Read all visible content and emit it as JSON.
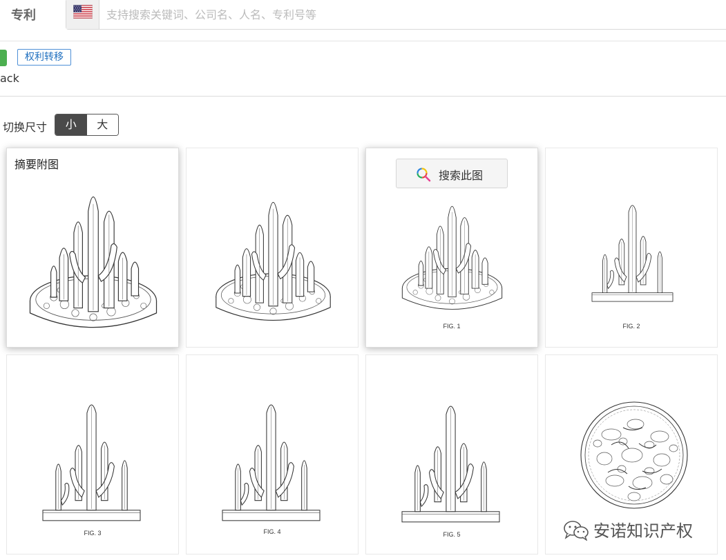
{
  "header": {
    "tab_label": "专利",
    "flag_icon": "us-flag-icon",
    "search_placeholder": "支持搜索关键词、公司名、人名、专利号等"
  },
  "tags": {
    "right_transfer": "权利转移",
    "partial_text": "ack",
    "badge_color": "#4caf50",
    "tag_color": "#1f6fbf"
  },
  "size_switch": {
    "label": "切换尺寸",
    "small": "小",
    "large": "大",
    "selected": "小"
  },
  "gallery": {
    "abstract_label": "摘要附图",
    "search_image_label": "搜索此图",
    "figures": [
      {
        "caption": ""
      },
      {
        "caption": ""
      },
      {
        "caption": "FIG. 1"
      },
      {
        "caption": "FIG. 2"
      },
      {
        "caption": "FIG. 3"
      },
      {
        "caption": "FIG. 4"
      },
      {
        "caption": "FIG. 5"
      },
      {
        "caption": ""
      }
    ]
  },
  "watermark": {
    "text": "安诺知识产权",
    "icon": "wechat-icon"
  }
}
